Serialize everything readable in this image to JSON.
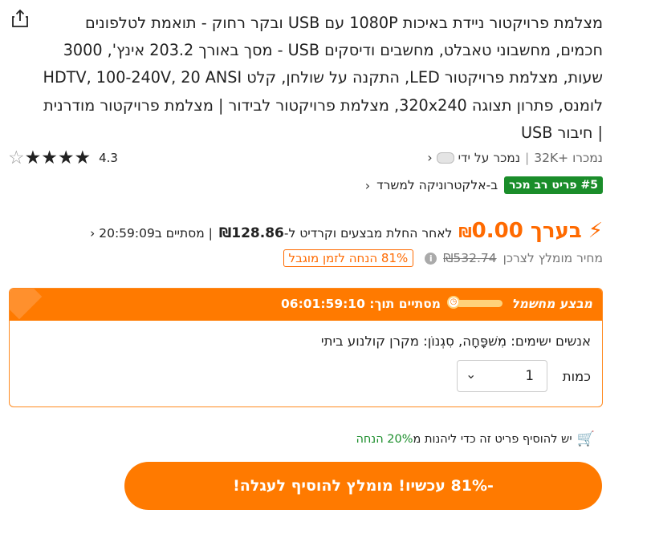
{
  "product": {
    "title": "מצלמת פרויקטור ניידת באיכות 1080P עם USB ובקר רחוק - תואמת לטלפונים חכמים, מחשבוני טאבלט, מחשבים ודיסקים USB - מסך באורך 203.2 אינץ', 3000 שעות, מצלמת פרויקטור LED, התקנה על שולחן, קלט HDTV, 100-240V, 20 ANSI לומנס, פתרון תצוגה 320x240, מצלמת פרויקטור לבידור | מצלמת פרויקטור מודרנית | חיבור USB",
    "rating": "4.3",
    "stars_full": 4,
    "sold": "נמכרו +32K",
    "sold_by": "נמכר על ידי",
    "rank_badge": "#5 פריט רב מכר",
    "rank_category": "ב-אלקטרוניקה למשרד"
  },
  "price": {
    "prefix": "בערך",
    "value": "0.00",
    "currency": "₪",
    "after_text": "לאחר החלת מבצעים וקרדיט ל-",
    "credit_value": "₪128.86",
    "ends_text": "| מסתיים ב",
    "ends_time": "20:59:09",
    "orig_label": "מחיר מומלץ לצרכן",
    "orig_price": "₪532.74",
    "discount_tag": "81% הנחה לזמן מוגבל"
  },
  "deal": {
    "title": "מבצע מחשמל",
    "ends_label": "מסתיים תוך:",
    "ends_time": "06:01:59:10",
    "variant": "אנשים ישימים: מִשׁפָּחָה, סִגְנוֹן: מקרן קולנוע ביתי",
    "qty_label": "כמות",
    "qty_value": "1"
  },
  "bundle": {
    "text": "יש להוסיף פריט זה כדי ליהנות מ",
    "link": "20% הנחה"
  },
  "cta": {
    "label": "-81% עכשיו! מומלץ להוסיף לעגלה!"
  },
  "colors": {
    "accent": "#ff7a00",
    "green": "#1a8d2a"
  }
}
